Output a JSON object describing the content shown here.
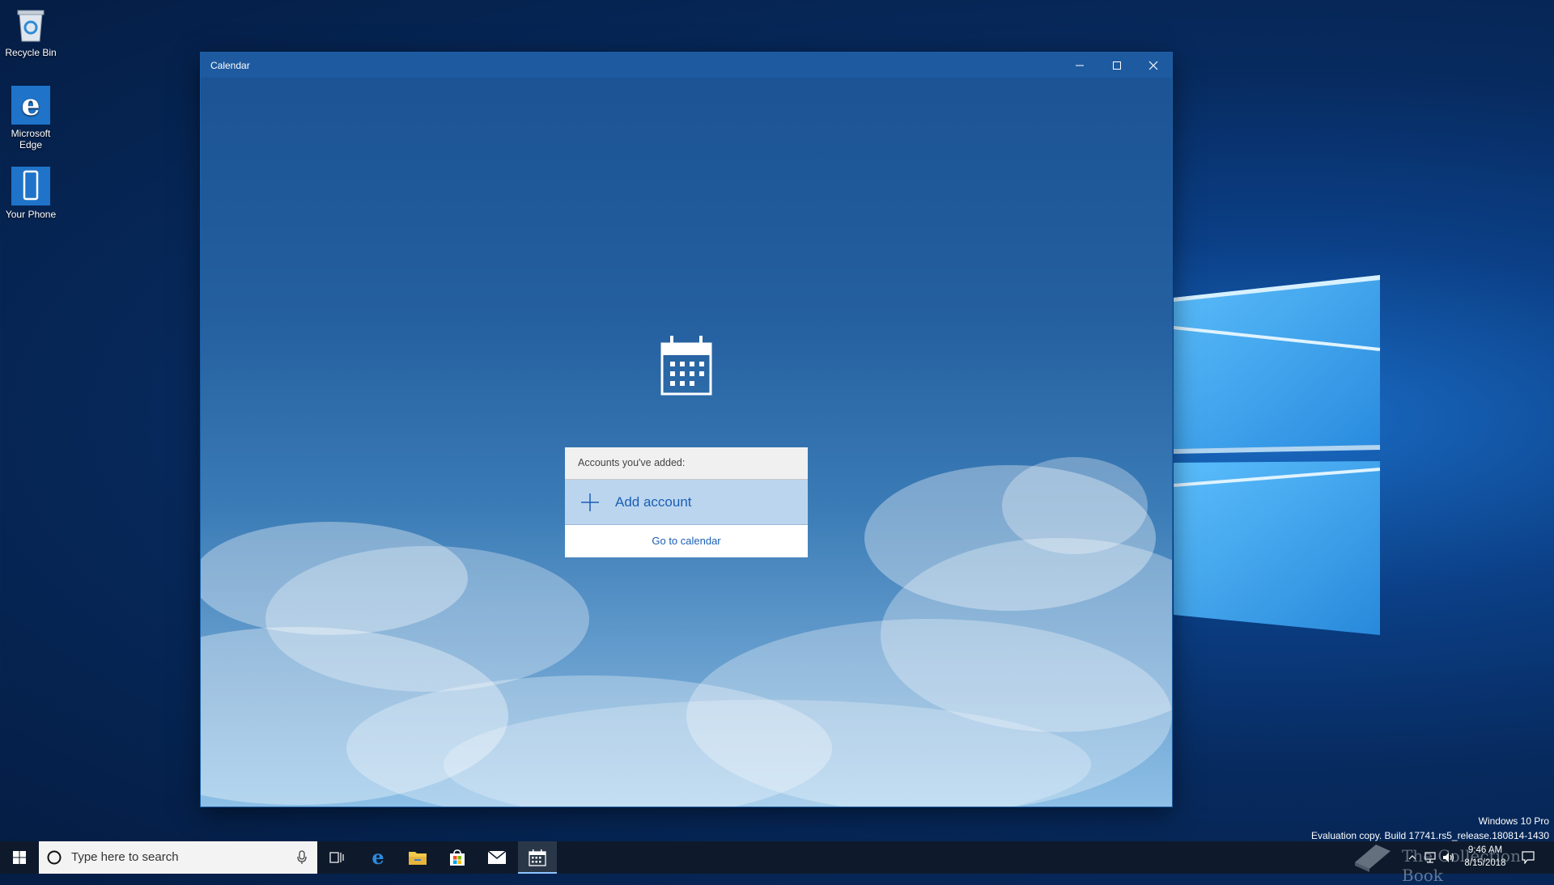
{
  "desktop": {
    "icons": [
      {
        "label": "Recycle Bin",
        "icon": "recycle-bin-icon"
      },
      {
        "label": "Microsoft Edge",
        "icon": "edge-icon"
      },
      {
        "label": "Your Phone",
        "icon": "phone-icon"
      }
    ],
    "watermark_line1": "Windows 10 Pro",
    "watermark_line2": "Evaluation copy. Build 17741.rs5_release.180814-1430",
    "overlay_text": "The Collection Book"
  },
  "window": {
    "title": "Calendar",
    "controls": [
      "minimize",
      "maximize",
      "close"
    ]
  },
  "accounts": {
    "header": "Accounts you've added:",
    "add_account_label": "Add account",
    "go_to_calendar_label": "Go to calendar"
  },
  "taskbar": {
    "search_placeholder": "Type here to search",
    "pinned": [
      "task-view-icon",
      "edge-icon",
      "file-explorer-icon",
      "store-icon",
      "mail-icon",
      "calendar-icon"
    ],
    "time": "9:46 AM",
    "date": "8/15/2018"
  },
  "colors": {
    "accent": "#1a5fb3",
    "titlebar": "#1d5aa0",
    "taskbar": "#0e1a2b"
  }
}
